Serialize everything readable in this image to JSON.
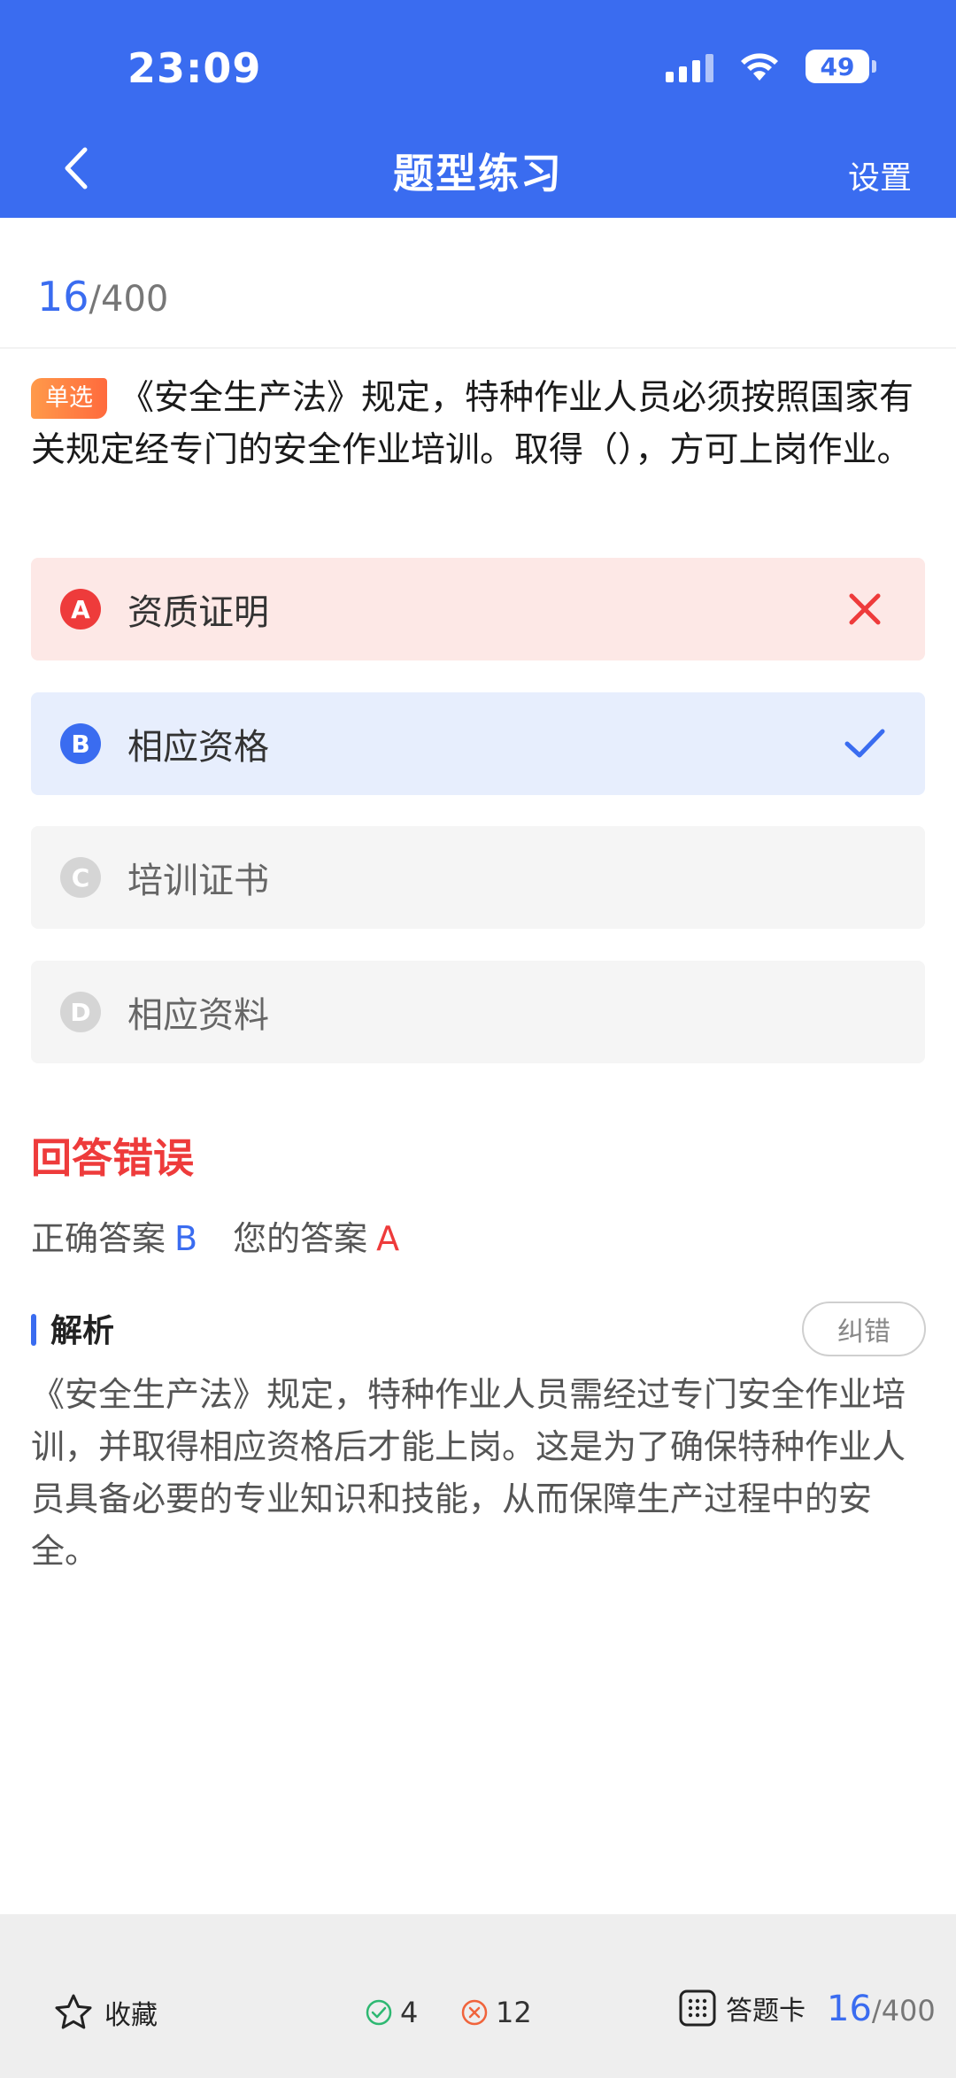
{
  "status_bar": {
    "time": "23:09",
    "battery": "49"
  },
  "nav": {
    "title": "题型练习",
    "settings_label": "设置"
  },
  "progress": {
    "current": "16",
    "total": "/400"
  },
  "question": {
    "type_badge": "单选",
    "text": "《安全生产法》规定，特种作业人员必须按照国家有关规定经专门的安全作业培训。取得（），方可上岗作业。"
  },
  "options": [
    {
      "letter": "A",
      "text": "资质证明",
      "state": "wrong"
    },
    {
      "letter": "B",
      "text": "相应资格",
      "state": "correct"
    },
    {
      "letter": "C",
      "text": "培训证书",
      "state": "neutral"
    },
    {
      "letter": "D",
      "text": "相应资料",
      "state": "neutral"
    }
  ],
  "result": {
    "title": "回答错误",
    "correct_label": "正确答案",
    "correct_value": "B",
    "your_label": "您的答案",
    "your_value": "A"
  },
  "analysis": {
    "title": "解析",
    "report_label": "纠错",
    "text": "《安全生产法》规定，特种作业人员需经过专门安全作业培训，并取得相应资格后才能上岗。这是为了确保特种作业人员具备必要的专业知识和技能，从而保障生产过程中的安全。"
  },
  "bottom_bar": {
    "favorite_label": "收藏",
    "right_count": "4",
    "wrong_count": "12",
    "answer_card_label": "答题卡",
    "progress_current": "16",
    "progress_total": "/400"
  },
  "colors": {
    "primary": "#3a6cf0",
    "error": "#ee3b3b",
    "badge": "#ff7a3d"
  }
}
